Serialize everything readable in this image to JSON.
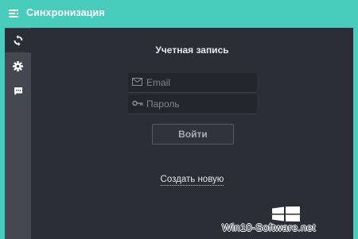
{
  "window": {
    "title": "Синхронизация"
  },
  "sidebar": {
    "items": [
      {
        "icon": "sync-icon",
        "active": true
      },
      {
        "icon": "gear-icon",
        "active": false
      },
      {
        "icon": "chat-icon",
        "active": false
      }
    ]
  },
  "account": {
    "heading": "Учетная запись",
    "email_placeholder": "Email",
    "password_placeholder": "Пароль",
    "login_label": "Войти",
    "create_label": "Создать новую"
  },
  "watermark": {
    "text": "Win10-Software.net"
  },
  "colors": {
    "accent": "#48cdbd",
    "panel": "#2b2e36",
    "sidebar": "#444850"
  }
}
